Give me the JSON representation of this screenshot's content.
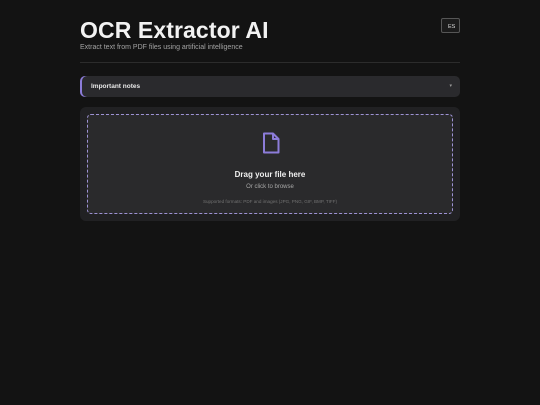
{
  "header": {
    "title": "OCR Extractor AI",
    "subtitle": "Extract text from PDF files using artificial intelligence",
    "language_button": "ES"
  },
  "notes": {
    "label": "Important notes",
    "chevron": "▾"
  },
  "upload": {
    "icon": "file-icon",
    "title": "Drag your file here",
    "subtitle": "Or click to browse",
    "formats": "Supported formats: PDF and images (JPG, PNG, GIF, BMP, TIFF)"
  },
  "colors": {
    "background": "#131313",
    "card": "#212123",
    "accent": "#8c7cd9"
  }
}
